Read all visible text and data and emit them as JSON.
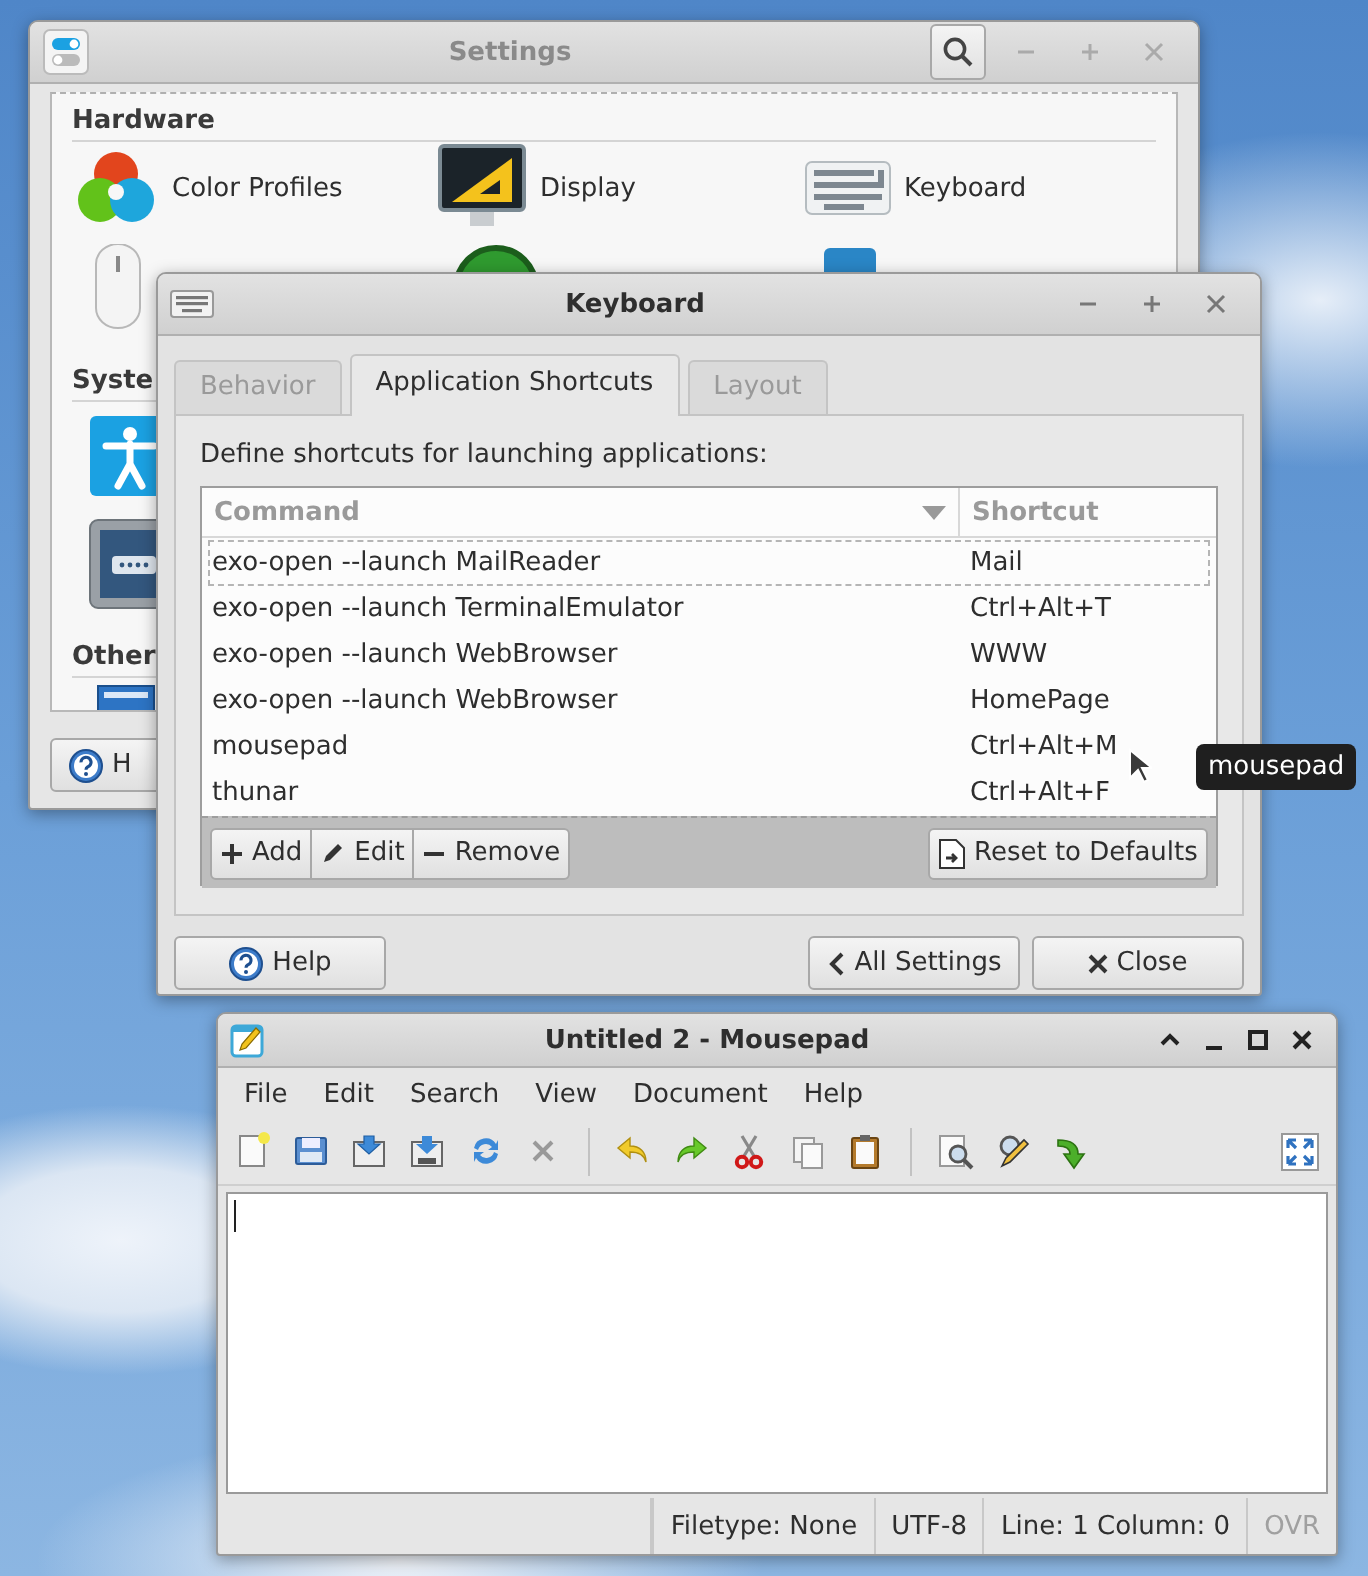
{
  "settings_window": {
    "title": "Settings",
    "active": false,
    "sections": [
      {
        "heading": "Hardware",
        "items": [
          {
            "label": "Color Profiles"
          },
          {
            "label": "Display"
          },
          {
            "label": "Keyboard"
          }
        ]
      },
      {
        "heading": "Syste"
      },
      {
        "heading": "Other"
      }
    ],
    "help_button": "H"
  },
  "keyboard_window": {
    "title": "Keyboard",
    "active": true,
    "tabs": [
      {
        "label": "Behavior",
        "selected": false
      },
      {
        "label": "Application Shortcuts",
        "selected": true
      },
      {
        "label": "Layout",
        "selected": false
      }
    ],
    "description": "Define shortcuts for launching applications:",
    "table": {
      "columns": [
        "Command",
        "Shortcut"
      ],
      "rows": [
        {
          "command": "exo-open --launch MailReader",
          "shortcut": "Mail",
          "focused": true
        },
        {
          "command": "exo-open --launch TerminalEmulator",
          "shortcut": "Ctrl+Alt+T",
          "focused": false
        },
        {
          "command": "exo-open --launch WebBrowser",
          "shortcut": "WWW",
          "focused": false
        },
        {
          "command": "exo-open --launch WebBrowser",
          "shortcut": "HomePage",
          "focused": false
        },
        {
          "command": "mousepad",
          "shortcut": "Ctrl+Alt+M",
          "focused": false
        },
        {
          "command": "thunar",
          "shortcut": "Ctrl+Alt+F",
          "focused": false
        }
      ]
    },
    "row_buttons": [
      "Add",
      "Edit",
      "Remove"
    ],
    "reset_button": "Reset to Defaults",
    "tooltip": "mousepad",
    "buttons": [
      "Help",
      "All Settings",
      "Close"
    ]
  },
  "mousepad_window": {
    "title": "Untitled 2 - Mousepad",
    "active": true,
    "menu": [
      "File",
      "Edit",
      "Search",
      "View",
      "Document",
      "Help"
    ],
    "status_bar": [
      {
        "text": "Filetype: None",
        "disabled": false
      },
      {
        "text": "UTF-8",
        "disabled": false
      },
      {
        "text": "Line: 1 Column: 0",
        "disabled": false
      },
      {
        "text": "OVR",
        "disabled": true
      }
    ]
  }
}
